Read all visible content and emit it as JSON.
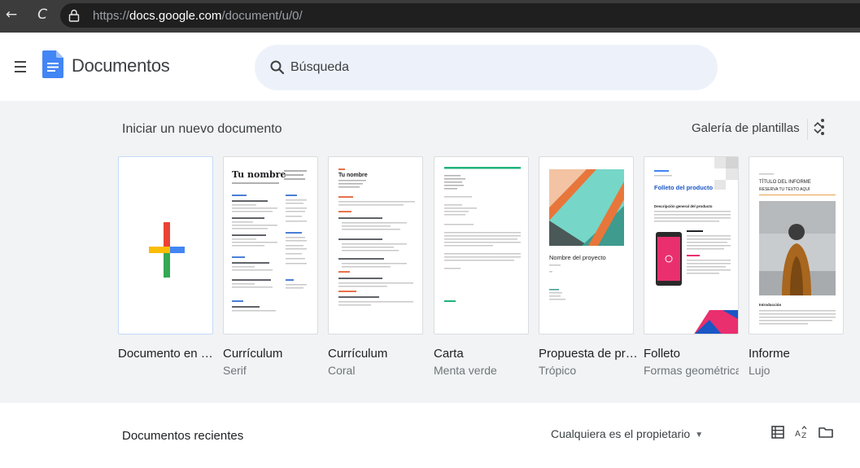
{
  "browser": {
    "back_glyph": "←",
    "reload_glyph": "C",
    "url_scheme": "https://",
    "url_host": "docs.google.com",
    "url_path": "/document/u/0/"
  },
  "header": {
    "app_title": "Documentos",
    "search_placeholder": "Búsqueda"
  },
  "templates_section": {
    "title": "Iniciar un nuevo documento",
    "gallery_label": "Galería de plantillas",
    "items": [
      {
        "name": "Documento en bla...",
        "subname": ""
      },
      {
        "name": "Currículum",
        "subname": "Serif",
        "preview_heading": "Tu nombre"
      },
      {
        "name": "Currículum",
        "subname": "Coral",
        "preview_heading": "Tu nombre"
      },
      {
        "name": "Carta",
        "subname": "Menta verde"
      },
      {
        "name": "Propuesta de proy...",
        "subname": "Trópico",
        "preview_heading": "Nombre del proyecto"
      },
      {
        "name": "Folleto",
        "subname": "Formas geométricas",
        "preview_heading": "Folleto del producto",
        "preview_subheading": "Descripción general del producto"
      },
      {
        "name": "Informe",
        "subname": "Lujo",
        "preview_heading": "TÍTULO DEL INFORME",
        "preview_subheading": "RESERVA TU TEXTO AQUÍ",
        "preview_section": "Introducción"
      }
    ]
  },
  "recent": {
    "title": "Documentos recientes",
    "owner_filter": "Cualquiera es el propietario"
  },
  "colors": {
    "docs_blue": "#4285f4",
    "google_red": "#ea4335",
    "google_yellow": "#fbbc04",
    "google_green": "#34a853",
    "coral": "#e8714a",
    "mint": "#1fb37b",
    "tropic_teal": "#76d6c8",
    "tropic_orange": "#e8763a",
    "brochure_pink": "#ea2f6e"
  },
  "icons": {
    "menu": "hamburger-menu-icon",
    "search": "search-icon",
    "unfold": "unfold-more-icon",
    "more": "more-vertical-icon",
    "list_view": "list-view-icon",
    "sort": "sort-az-icon",
    "folder": "folder-icon"
  }
}
